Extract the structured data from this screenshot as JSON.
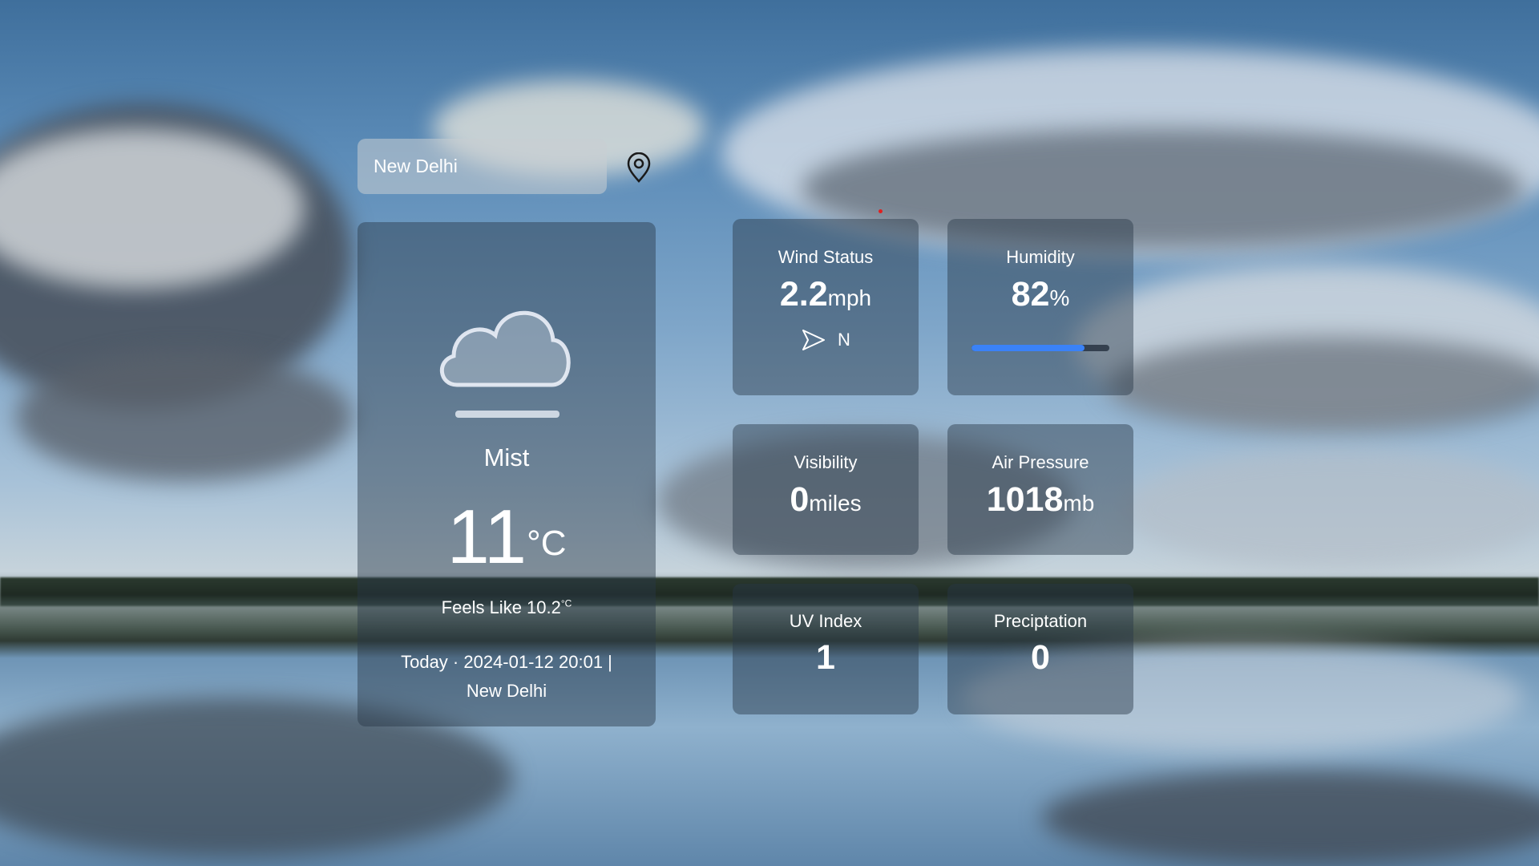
{
  "search": {
    "value": "New Delhi",
    "placeholder": "New Delhi"
  },
  "current": {
    "icon": "cloud-mist-icon",
    "condition": "Mist",
    "temperature": "11",
    "temperature_unit": "°C",
    "feels_like_label": "Feels Like 10.2",
    "feels_like_unit": "°C",
    "date_line": "Today · 2024-01-12 20:01 |",
    "location_line": "New Delhi"
  },
  "tiles": {
    "wind": {
      "title": "Wind Status",
      "value": "2.2",
      "unit": "mph",
      "direction": "N",
      "icon": "navigation-arrow-icon"
    },
    "humidity": {
      "title": "Humidity",
      "value": "82",
      "unit": "%",
      "level": 0.82,
      "bar_color": "#3a82f7"
    },
    "visibility": {
      "title": "Visibility",
      "value": "0",
      "unit": "miles"
    },
    "air_pressure": {
      "title": "Air Pressure",
      "value": "1018",
      "unit": "mb"
    },
    "uv_index": {
      "title": "UV Index",
      "value": "1"
    },
    "precipitation": {
      "title": "Preciptation",
      "value": "0"
    }
  }
}
